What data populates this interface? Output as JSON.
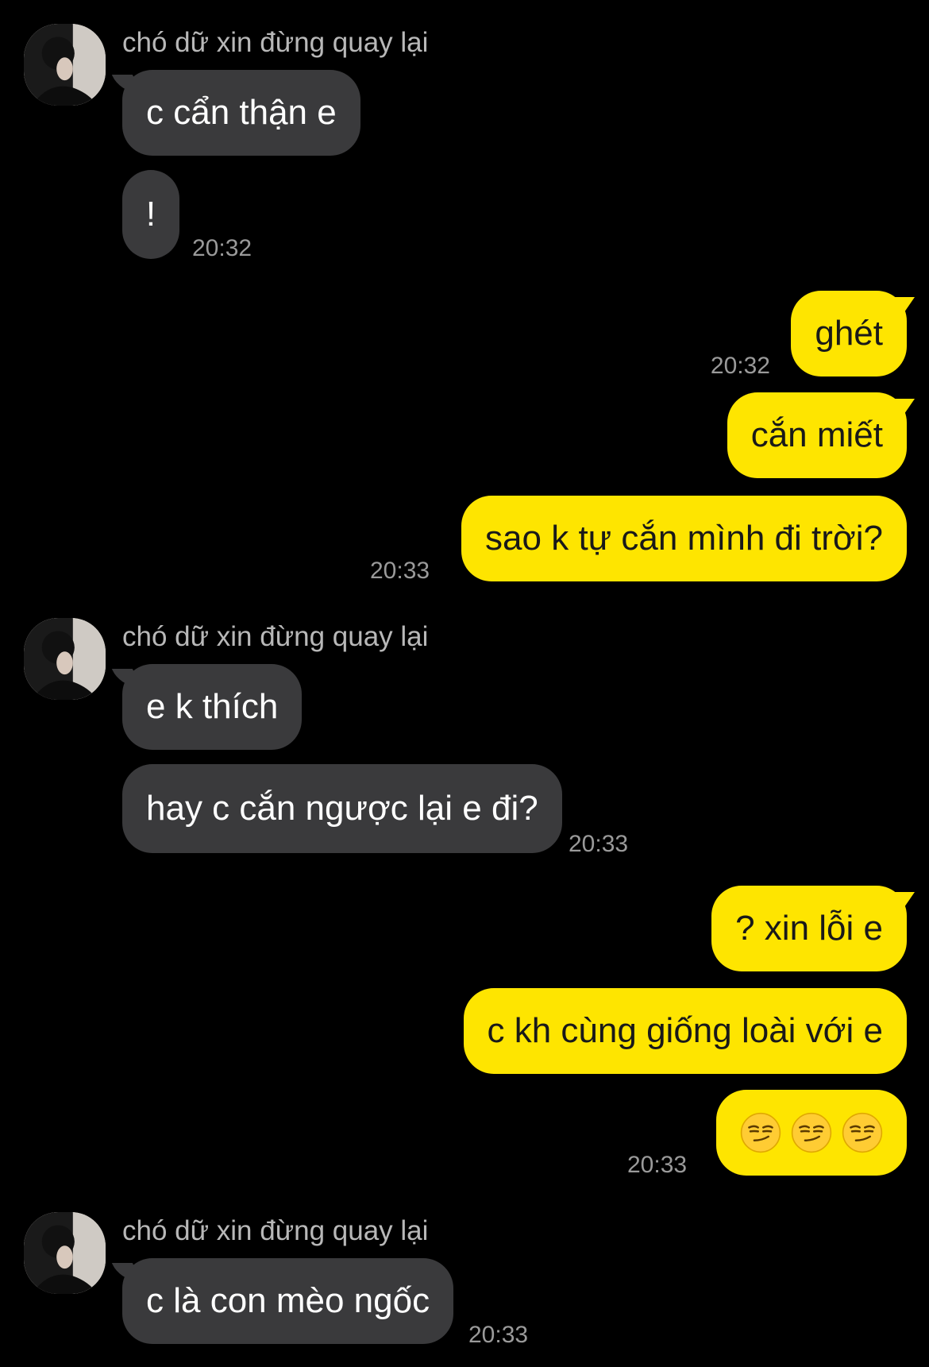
{
  "sender_name": "chó dữ xin đừng quay lại",
  "messages": {
    "m1": "c cẩn thận e",
    "m2": "!",
    "m3": "ghét",
    "m4": "cắn miết",
    "m5": "sao k tự cắn mình đi trời?",
    "m6": "e k thích",
    "m7": "hay c cắn ngược lại e đi?",
    "m8": "? xin lỗi e",
    "m9": "c kh cùng giống loài với e",
    "m10_emoji": [
      "smirking-face",
      "smirking-face",
      "smirking-face"
    ],
    "m11": "c là con mèo ngốc"
  },
  "times": {
    "t1": "20:32",
    "t2": "20:32",
    "t3": "20:33",
    "t4": "20:33",
    "t5": "20:33",
    "t6": "20:33"
  },
  "colors": {
    "background": "#000000",
    "incoming_bubble": "#3a3a3c",
    "outgoing_bubble": "#fee500",
    "timestamp": "#9a9a9a"
  }
}
